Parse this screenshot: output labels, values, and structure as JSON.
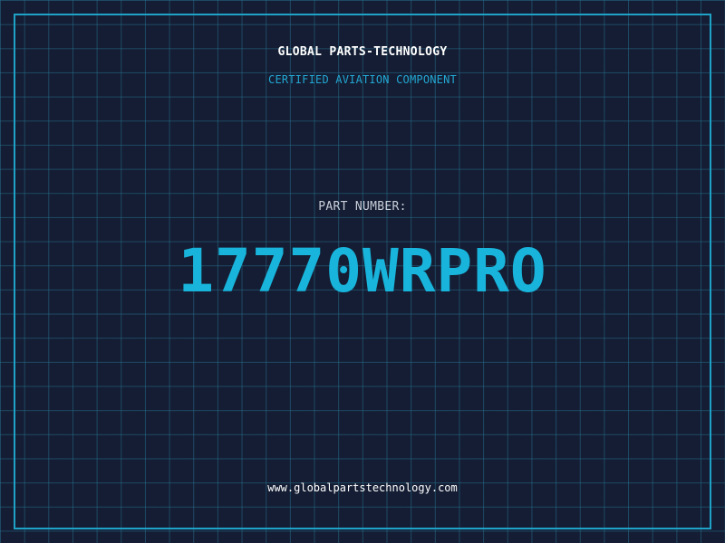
{
  "brand": {
    "name": "GLOBAL PARTS-TECHNOLOGY",
    "tagline": "CERTIFIED AVIATION COMPONENT"
  },
  "part": {
    "label": "PART NUMBER:",
    "number": "17770WRPRO"
  },
  "footer": {
    "website": "www.globalpartstechnology.com"
  },
  "colors": {
    "background": "#141d33",
    "grid": "#266e8c",
    "frame": "#1fa2c8",
    "accent": "#18b4db"
  }
}
